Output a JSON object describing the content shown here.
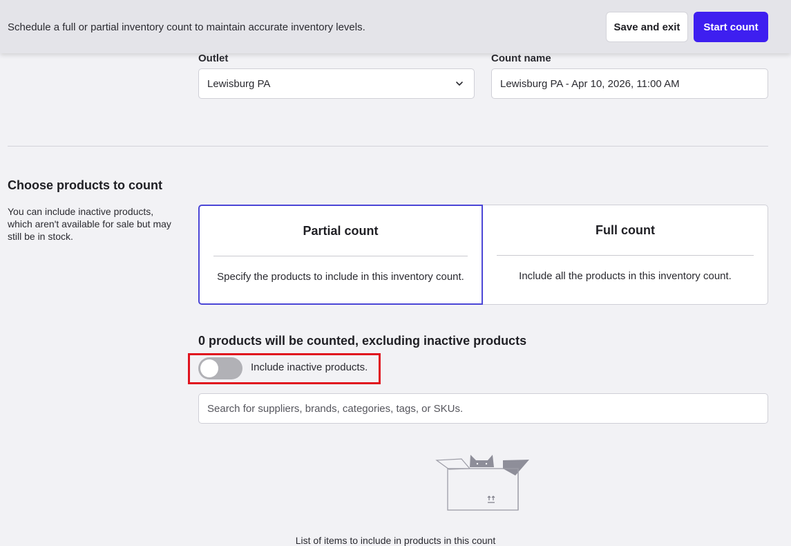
{
  "header": {
    "subtitle": "Schedule a full or partial inventory count to maintain accurate inventory levels.",
    "save_exit_label": "Save and exit",
    "start_count_label": "Start count"
  },
  "form": {
    "outlet_label": "Outlet",
    "outlet_value": "Lewisburg PA",
    "count_name_label": "Count name",
    "count_name_value": "Lewisburg PA - Apr 10, 2026, 11:00 AM"
  },
  "products": {
    "title": "Choose products to count",
    "description": "You can include inactive products, which aren't available for sale but may still be in stock.",
    "options": [
      {
        "title": "Partial count",
        "description": "Specify the products to include in this inventory count.",
        "selected": true
      },
      {
        "title": "Full count",
        "description": "Include all the products in this inventory count.",
        "selected": false
      }
    ],
    "count_summary": "0 products will be counted, excluding inactive products",
    "toggle_label": "Include inactive products.",
    "toggle_on": false,
    "search_placeholder": "Search for suppliers, brands, categories, tags, or SKUs.",
    "empty_text": "List of items to include in products in this count"
  },
  "colors": {
    "primary": "#3e1ff0",
    "selected_border": "#4b46d6",
    "highlight": "#e0131e"
  }
}
